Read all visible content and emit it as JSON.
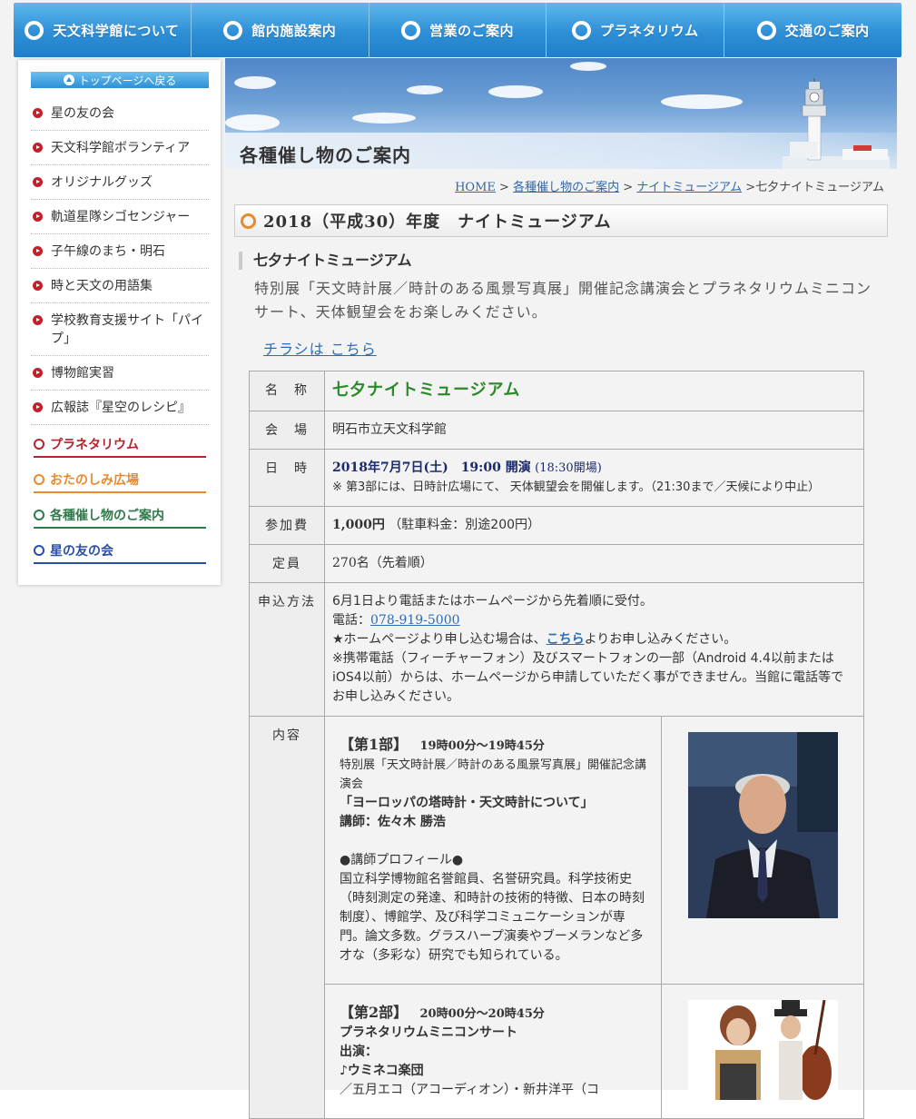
{
  "nav": {
    "items": [
      {
        "label": "天文科学館について"
      },
      {
        "label": "館内施設案内"
      },
      {
        "label": "営業のご案内"
      },
      {
        "label": "プラネタリウム"
      },
      {
        "label": "交通のご案内"
      }
    ]
  },
  "sidebar": {
    "back_label": "トップページへ戻る",
    "items": [
      {
        "label": "星の友の会"
      },
      {
        "label": "天文科学館ボランティア"
      },
      {
        "label": "オリジナルグッズ"
      },
      {
        "label": "軌道星隊シゴセンジャー"
      },
      {
        "label": "子午線のまち・明石"
      },
      {
        "label": "時と天文の用語集"
      },
      {
        "label": "学校教育支援サイト「パイプ」"
      },
      {
        "label": "博物館実習"
      },
      {
        "label": "広報誌『星空のレシピ』"
      }
    ],
    "categories": [
      {
        "label": "プラネタリウム",
        "color": "#b3242c"
      },
      {
        "label": "おたのしみ広場",
        "color": "#e8892d"
      },
      {
        "label": "各種催し物のご案内",
        "color": "#2f7a4a"
      },
      {
        "label": "星の友の会",
        "color": "#2a4ea8"
      }
    ]
  },
  "banner": {
    "title": "各種催し物のご案内"
  },
  "breadcrumb": {
    "home": "HOME",
    "sep": ">",
    "events": "各種催し物のご案内",
    "night": "ナイトミュージアム",
    "current": "七夕ナイトミュージアム"
  },
  "main": {
    "year_title": "2018（平成30）年度　ナイトミュージアム",
    "event_name": "七夕ナイトミュージアム",
    "lead": "特別展「天文時計展／時計のある風景写真展」開催記念講演会とプラネタリウムミニコンサート、天体観望会をお楽しみください。",
    "flyer_link": "チラシは こちら"
  },
  "table": {
    "name_label": "名　称",
    "name_value": "七夕ナイトミュージアム",
    "venue_label": "会　場",
    "venue_value": "明石市立天文科学館",
    "date_label": "日　時",
    "date_main": "2018年7月7日(土)　19:00 開演",
    "date_open": "(18:30開場)",
    "date_note": "※ 第3部には、日時計広場にて、 天体観望会を開催します。（21:30まで／天候により中止）",
    "fee_label": "参加費",
    "fee_value": "1,000円",
    "fee_note": "（駐車料金：別途200円）",
    "capacity_label": "定員",
    "capacity_value": "270名（先着順）",
    "apply_label": "申込方法",
    "apply_line1": "6月1日より電話またはホームページから先着順に受付。",
    "apply_tel_prefix": "電話：",
    "apply_tel": "078-919-5000",
    "apply_web_prefix": "★ホームページより申し込む場合は、",
    "apply_web_link": "こちら",
    "apply_web_suffix": "よりお申し込みください。",
    "apply_note": "※携帯電話（フィーチャーフォン）及びスマートフォンの一部（Android 4.4以前またはiOS4以前）からは、ホームページから申請していただく事ができません。当館に電話等でお申し込みください。",
    "content_label": "内容",
    "part1": {
      "head": "【第1部】",
      "time": "19時00分～19時45分",
      "desc": "特別展「天文時計展／時計のある風景写真展」開催記念講演会",
      "title": "「ヨーロッパの塔時計・天文時計について」",
      "speaker": "講師：佐々木 勝浩",
      "profile_head": "●講師プロフィール●",
      "profile": "国立科学博物館名誉館員、名誉研究員。科学技術史（時刻測定の発達、和時計の技術的特徴、日本の時刻制度）、博館学、及び科学コミュニケーションが専門。論文多数。グラスハープ演奏やブーメランなど多才な（多彩な）研究でも知られている。"
    },
    "part2": {
      "head": "【第2部】",
      "time": "20時00分～20時45分",
      "title": "プラネタリウムミニコンサート",
      "perf_label": "出演：",
      "group": "♪ウミネコ楽団",
      "members": "／五月エコ（アコーディオン）・新井洋平（コ"
    }
  }
}
